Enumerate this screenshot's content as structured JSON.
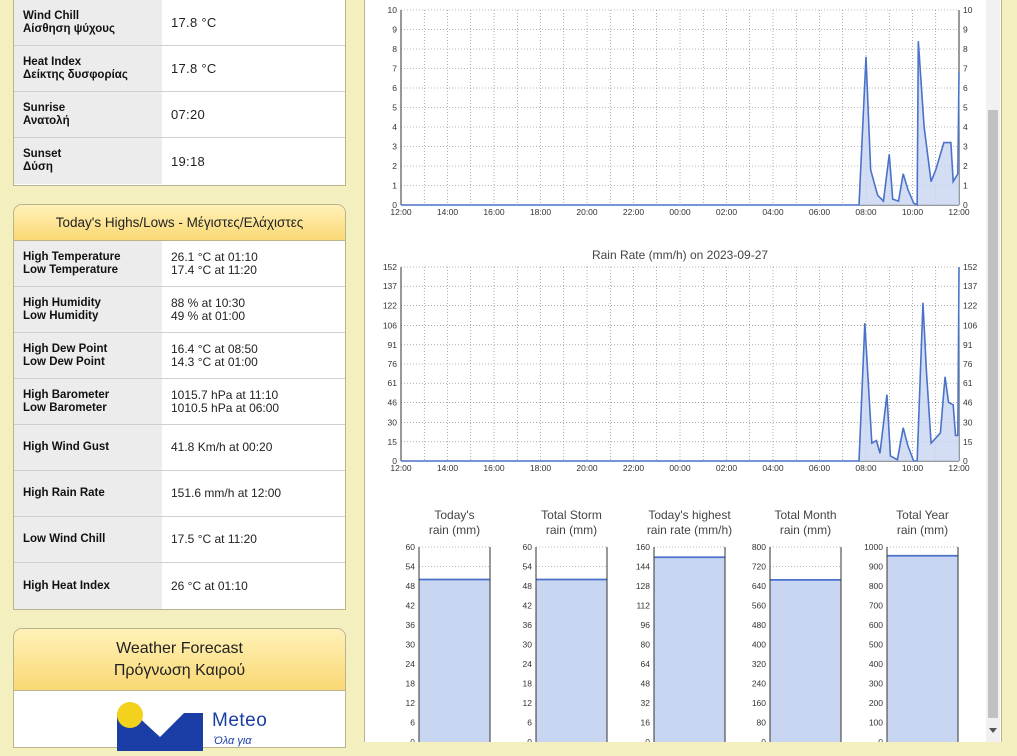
{
  "current": [
    {
      "label_en": "Wind Chill",
      "label_gr": "Αίσθηση ψύχους",
      "value": "17.8 °C"
    },
    {
      "label_en": "Heat Index",
      "label_gr": "Δείκτης δυσφορίας",
      "value": "17.8 °C"
    },
    {
      "label_en": "Sunrise",
      "label_gr": "Ανατολή",
      "value": "07:20"
    },
    {
      "label_en": "Sunset",
      "label_gr": "Δύση",
      "value": "19:18"
    }
  ],
  "highs_lows": {
    "title": "Today's Highs/Lows - Μέγιστες/Ελάχιστες",
    "rows": [
      {
        "l1": "High Temperature",
        "l2": "Low Temperature",
        "v1": "26.1 °C at 01:10",
        "v2": "17.4 °C at 11:20"
      },
      {
        "l1": "High Humidity",
        "l2": "Low Humidity",
        "v1": "88 % at 10:30",
        "v2": "49 % at 01:00"
      },
      {
        "l1": "High Dew Point",
        "l2": "Low Dew Point",
        "v1": "16.4 °C at 08:50",
        "v2": "14.3 °C at 01:00"
      },
      {
        "l1": "High Barometer",
        "l2": "Low Barometer",
        "v1": "1015.7 hPa at 11:10",
        "v2": "1010.5 hPa at 06:00"
      },
      {
        "l1": "High Wind Gust",
        "l2": "",
        "v1": "41.8 Km/h at 00:20",
        "v2": ""
      },
      {
        "l1": "High Rain Rate",
        "l2": "",
        "v1": "151.6 mm/h at 12:00",
        "v2": ""
      },
      {
        "l1": "Low Wind Chill",
        "l2": "",
        "v1": "17.5 °C at 11:20",
        "v2": ""
      },
      {
        "l1": "High Heat Index",
        "l2": "",
        "v1": "26 °C at 01:10",
        "v2": ""
      }
    ]
  },
  "forecast": {
    "title_en": "Weather Forecast",
    "title_gr": "Πρόγνωση Καιρού",
    "logo_text": "Meteo",
    "logo_sub": "Όλα για"
  },
  "chart_data": [
    {
      "type": "area",
      "title": "",
      "x_ticks": [
        "12:00",
        "14:00",
        "16:00",
        "18:00",
        "20:00",
        "22:00",
        "00:00",
        "02:00",
        "04:00",
        "06:00",
        "08:00",
        "10:00",
        "12:00"
      ],
      "y_ticks": [
        0,
        1,
        2,
        3,
        4,
        5,
        6,
        7,
        8,
        9,
        10
      ],
      "ylim": [
        0,
        10
      ],
      "x_range_hours": [
        0,
        24
      ],
      "points": [
        [
          0,
          0
        ],
        [
          19.7,
          0
        ],
        [
          20.0,
          7.6
        ],
        [
          20.2,
          1.8
        ],
        [
          20.5,
          0.5
        ],
        [
          20.75,
          0.2
        ],
        [
          21.0,
          2.6
        ],
        [
          21.15,
          0.3
        ],
        [
          21.4,
          0.2
        ],
        [
          21.6,
          1.6
        ],
        [
          21.8,
          0.8
        ],
        [
          22.05,
          0.1
        ],
        [
          22.2,
          0
        ],
        [
          22.25,
          8.4
        ],
        [
          22.5,
          4.0
        ],
        [
          22.8,
          1.2
        ],
        [
          23.0,
          1.8
        ],
        [
          23.35,
          3.2
        ],
        [
          23.65,
          3.2
        ],
        [
          23.75,
          1.2
        ],
        [
          23.95,
          1.6
        ],
        [
          24.0,
          6.8
        ]
      ],
      "grid": true,
      "color": "#4a72c8"
    },
    {
      "type": "area",
      "title": "Rain Rate (mm/h) on 2023-09-27",
      "x_ticks": [
        "12:00",
        "14:00",
        "16:00",
        "18:00",
        "20:00",
        "22:00",
        "00:00",
        "02:00",
        "04:00",
        "06:00",
        "08:00",
        "10:00",
        "12:00"
      ],
      "y_ticks": [
        0,
        15,
        30,
        46,
        61,
        76,
        91,
        106,
        122,
        137,
        152
      ],
      "ylim": [
        0,
        152
      ],
      "x_range_hours": [
        0,
        24
      ],
      "points": [
        [
          0,
          0
        ],
        [
          19.7,
          0
        ],
        [
          19.95,
          108
        ],
        [
          20.25,
          14
        ],
        [
          20.45,
          16
        ],
        [
          20.6,
          6
        ],
        [
          20.9,
          52
        ],
        [
          21.05,
          4
        ],
        [
          21.35,
          1
        ],
        [
          21.6,
          26
        ],
        [
          21.8,
          12
        ],
        [
          22.05,
          0
        ],
        [
          22.2,
          0
        ],
        [
          22.45,
          124
        ],
        [
          22.6,
          70
        ],
        [
          22.8,
          14
        ],
        [
          23.0,
          18
        ],
        [
          23.2,
          22
        ],
        [
          23.4,
          66
        ],
        [
          23.55,
          46
        ],
        [
          23.75,
          44
        ],
        [
          23.85,
          20
        ],
        [
          23.95,
          20
        ],
        [
          24.0,
          152
        ]
      ],
      "grid": true,
      "color": "#4a72c8"
    },
    {
      "type": "bar",
      "title": "Today's rain (mm)",
      "title_lines": [
        "Today's",
        "rain (mm)"
      ],
      "y_ticks": [
        0,
        6,
        12,
        18,
        24,
        30,
        36,
        42,
        48,
        54,
        60
      ],
      "ylim": [
        0,
        60
      ],
      "value": 50
    },
    {
      "type": "bar",
      "title": "Total Storm rain (mm)",
      "title_lines": [
        "Total Storm",
        "rain (mm)"
      ],
      "y_ticks": [
        0,
        6,
        12,
        18,
        24,
        30,
        36,
        42,
        48,
        54,
        60
      ],
      "ylim": [
        0,
        60
      ],
      "value": 50
    },
    {
      "type": "bar",
      "title": "Today's highest rain rate (mm/h)",
      "title_lines": [
        "Today's highest",
        "rain rate (mm/h)"
      ],
      "y_ticks": [
        0,
        16,
        32,
        48,
        64,
        80,
        96,
        112,
        128,
        144,
        160
      ],
      "ylim": [
        0,
        160
      ],
      "value": 151.6
    },
    {
      "type": "bar",
      "title": "Total Month rain (mm)",
      "title_lines": [
        "Total Month",
        "rain (mm)"
      ],
      "y_ticks": [
        0,
        80,
        160,
        240,
        320,
        400,
        480,
        560,
        640,
        720,
        800
      ],
      "ylim": [
        0,
        800
      ],
      "value": 665
    },
    {
      "type": "bar",
      "title": "Total Year rain (mm)",
      "title_lines": [
        "Total Year",
        "rain (mm)"
      ],
      "y_ticks": [
        0,
        100,
        200,
        300,
        400,
        500,
        600,
        700,
        800,
        900,
        1000
      ],
      "ylim": [
        0,
        1000
      ],
      "value": 955
    }
  ],
  "colors": {
    "page_bg": "#f3efbf",
    "header_gradient_top": "#fff2b8",
    "header_gradient_bottom": "#fad874",
    "series": "#4a72c8",
    "fill": "#c8d6f2"
  }
}
